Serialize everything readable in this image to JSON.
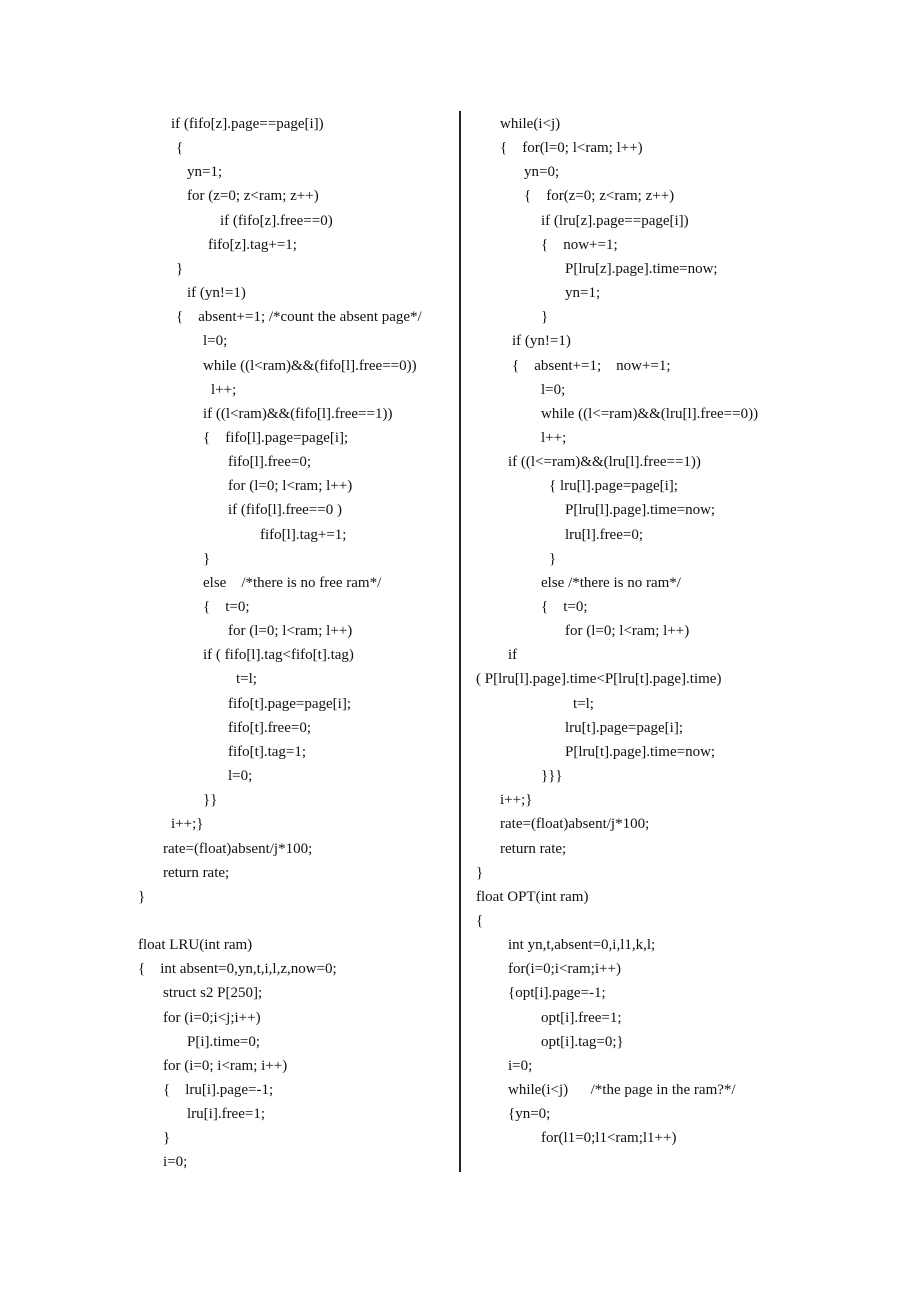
{
  "document": {
    "left_column": [
      "if (fifo[z].page==page[i])",
      "{",
      "yn=1;",
      "for (z=0; z<ram; z++)",
      "if (fifo[z].free==0)",
      "fifo[z].tag+=1;",
      "}",
      "if (yn!=1)",
      "{    absent+=1; /*count the absent page*/",
      "l=0;",
      "while ((l<ram)&&(fifo[l].free==0))",
      "l++;",
      "if ((l<ram)&&(fifo[l].free==1))",
      "{    fifo[l].page=page[i];",
      "fifo[l].free=0;",
      "for (l=0; l<ram; l++)",
      "if (fifo[l].free==0 )",
      "fifo[l].tag+=1;",
      "}",
      "else    /*there is no free ram*/",
      "{    t=0;",
      "for (l=0; l<ram; l++)",
      "if ( fifo[l].tag<fifo[t].tag)",
      "t=l;",
      "fifo[t].page=page[i];",
      "fifo[t].free=0;",
      "fifo[t].tag=1;",
      "l=0;",
      "}}",
      "i++;}",
      "rate=(float)absent/j*100;",
      "return rate;",
      "}",
      "",
      "float LRU(int ram)",
      "{    int absent=0,yn,t,i,l,z,now=0;",
      "struct s2 P[250];",
      "for (i=0;i<j;i++)",
      "P[i].time=0;",
      "for (i=0; i<ram; i++)",
      "{    lru[i].page=-1;",
      "lru[i].free=1;",
      "}",
      "i=0;"
    ],
    "right_column": [
      "while(i<j)",
      "{    for(l=0; l<ram; l++)",
      "yn=0;",
      "{    for(z=0; z<ram; z++)",
      "if (lru[z].page==page[i])",
      "{    now+=1;",
      "P[lru[z].page].time=now;",
      "yn=1;",
      "}",
      "if (yn!=1)",
      "{    absent+=1;    now+=1;",
      "l=0;",
      "while ((l<=ram)&&(lru[l].free==0))",
      "l++;",
      "if ((l<=ram)&&(lru[l].free==1))",
      "{ lru[l].page=page[i];",
      "P[lru[l].page].time=now;",
      "lru[l].free=0;",
      "}",
      "else /*there is no ram*/",
      "{    t=0;",
      "for (l=0; l<ram; l++)",
      "if",
      "( P[lru[l].page].time<P[lru[t].page].time)",
      "t=l;",
      "lru[t].page=page[i];",
      "P[lru[t].page].time=now;",
      "}}}",
      "i++;}",
      "rate=(float)absent/j*100;",
      "return rate;",
      "}",
      "float OPT(int ram)",
      "{",
      "int yn,t,absent=0,i,l1,k,l;",
      "for(i=0;i<ram;i++)",
      "{opt[i].page=-1;",
      "opt[i].free=1;",
      "opt[i].tag=0;}",
      "i=0;",
      "while(i<j)      /*the page in the ram?*/",
      "{yn=0;",
      "for(l1=0;l1<ram;l1++)"
    ]
  }
}
